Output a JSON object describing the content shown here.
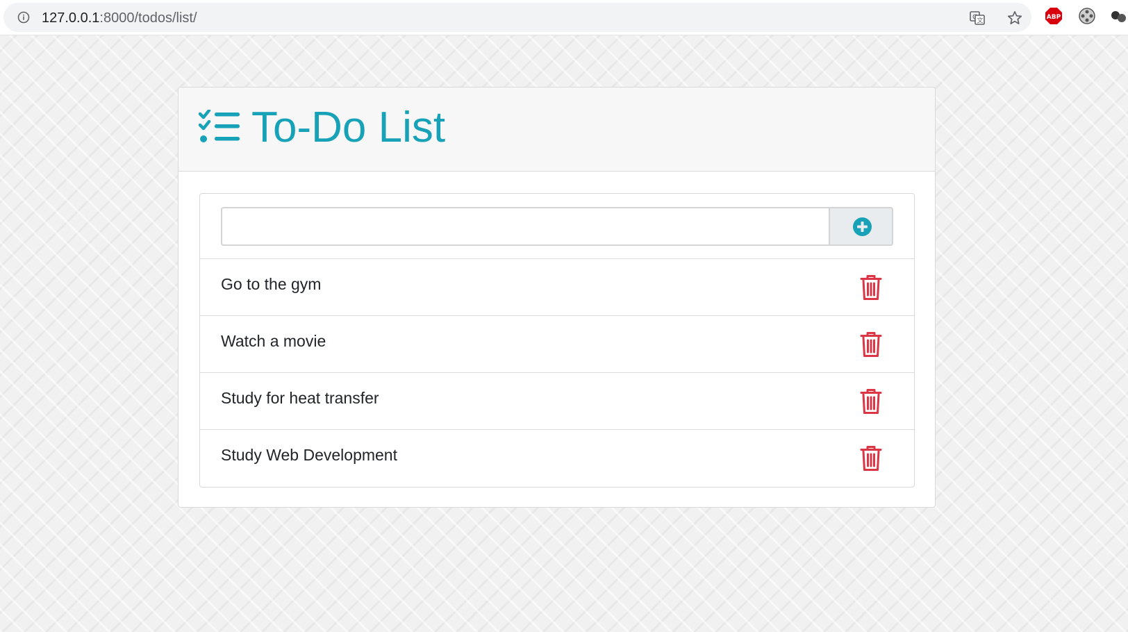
{
  "browser": {
    "url_host": "127.0.0.1",
    "url_path": ":8000/todos/list/",
    "abp_label": "ABP"
  },
  "app": {
    "title": "To-Do List",
    "accent_color": "#17a2b8",
    "danger_color": "#dc3545",
    "title_icon": "list-check-icon"
  },
  "add_form": {
    "input_value": "",
    "input_placeholder": "",
    "button_icon": "plus-circle-icon"
  },
  "todos": [
    {
      "text": "Go to the gym"
    },
    {
      "text": "Watch a movie"
    },
    {
      "text": "Study for heat transfer"
    },
    {
      "text": "Study Web Development"
    }
  ]
}
